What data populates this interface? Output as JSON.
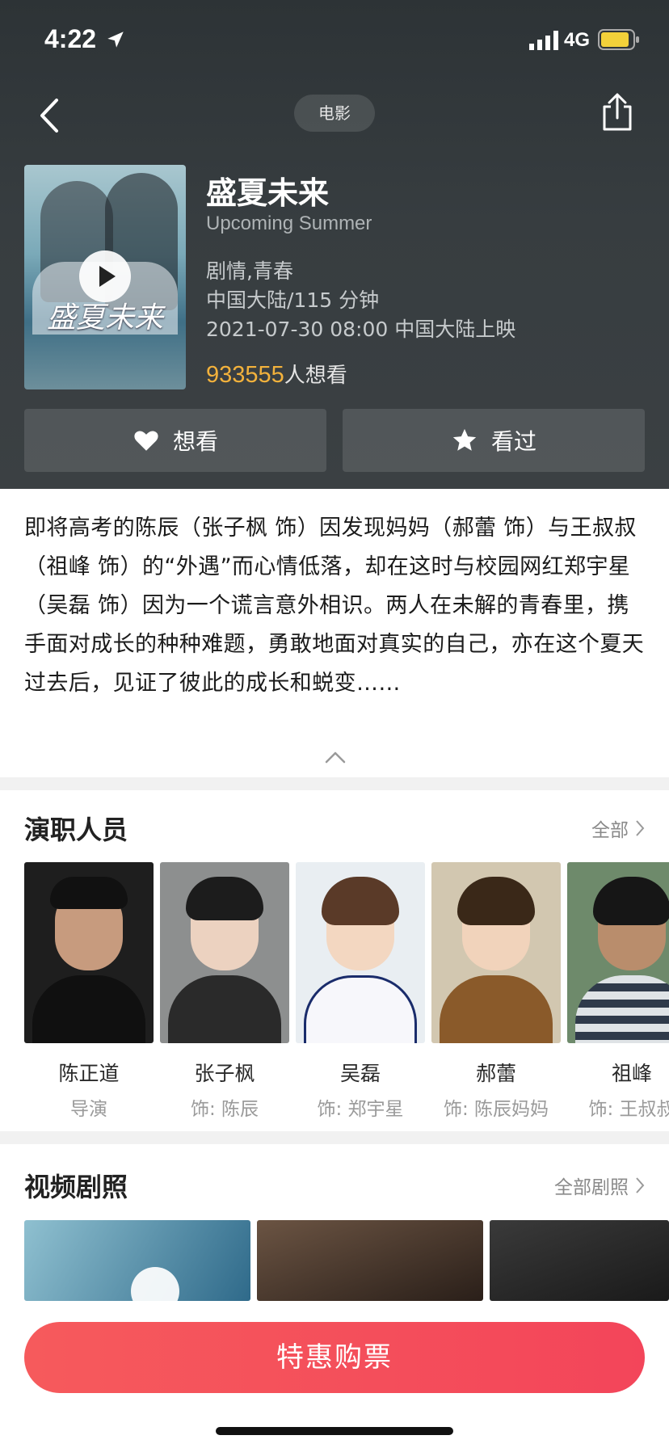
{
  "status_bar": {
    "time": "4:22",
    "network": "4G"
  },
  "header": {
    "category": "电影"
  },
  "movie": {
    "title": "盛夏未来",
    "english_title": "Upcoming Summer",
    "genres": "剧情,青春",
    "region_duration": "中国大陆/115 分钟",
    "release": "2021-07-30 08:00 中国大陆上映",
    "want_count": "933555",
    "want_suffix": "人想看",
    "poster_title": "盛夏未来"
  },
  "actions": {
    "want": "想看",
    "watched": "看过"
  },
  "synopsis": "即将高考的陈辰（张子枫 饰）因发现妈妈（郝蕾 饰）与王叔叔（祖峰 饰）的“外遇”而心情低落，却在这时与校园网红郑宇星（吴磊 饰）因为一个谎言意外相识。两人在未解的青春里，携手面对成长的种种难题，勇敢地面对真实的自己，亦在这个夏天过去后，见证了彼此的成长和蜕变……",
  "cast_section": {
    "title": "演职人员",
    "more": "全部",
    "members": [
      {
        "name": "陈正道",
        "role": "导演"
      },
      {
        "name": "张子枫",
        "role": "饰: 陈辰"
      },
      {
        "name": "吴磊",
        "role": "饰: 郑宇星"
      },
      {
        "name": "郝蕾",
        "role": "饰: 陈辰妈妈"
      },
      {
        "name": "祖峰",
        "role": "饰: 王叔叔"
      }
    ]
  },
  "video_section": {
    "title": "视频剧照",
    "more": "全部剧照"
  },
  "buy_button": "特惠购票",
  "colors": {
    "accent_gold": "#f3b23c",
    "buy_red": "#f4495b",
    "header_bg": "#363c3f"
  }
}
